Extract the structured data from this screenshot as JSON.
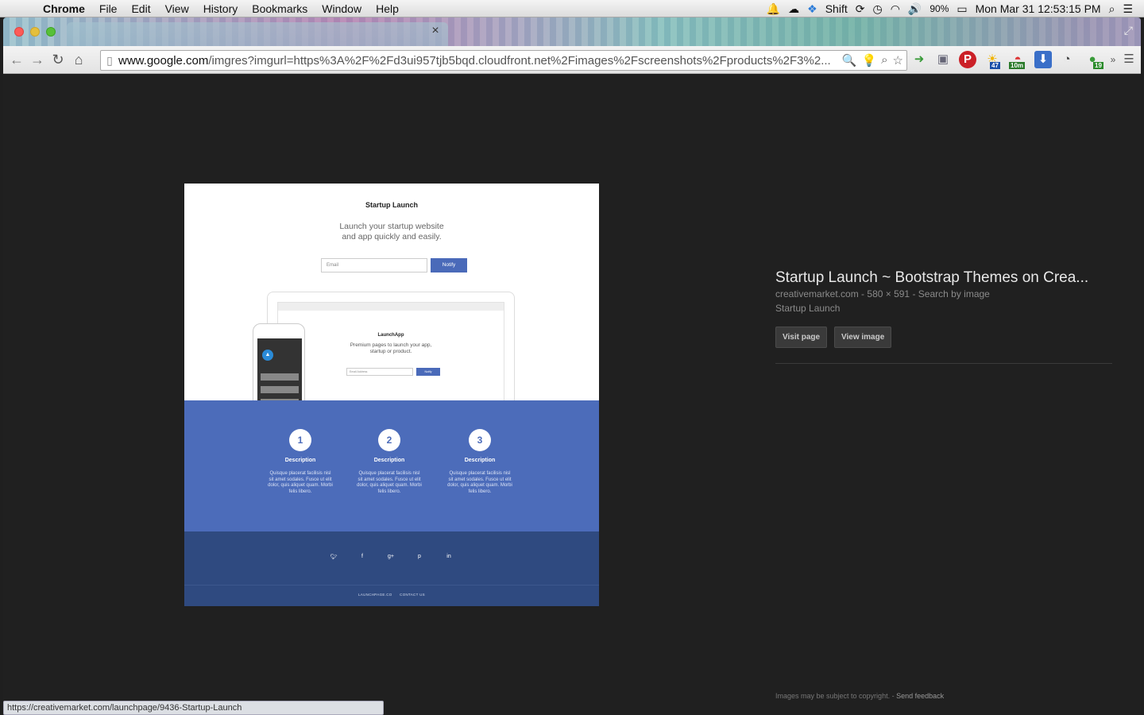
{
  "menubar": {
    "app_name": "Chrome",
    "menus": [
      "File",
      "Edit",
      "View",
      "History",
      "Bookmarks",
      "Window",
      "Help"
    ],
    "status": {
      "shift_label": "Shift",
      "battery": "90%",
      "clock": "Mon Mar 31  12:53:15 PM"
    }
  },
  "tab": {
    "close_glyph": "×"
  },
  "toolbar": {
    "url_host": "www.google.com",
    "url_path": "/imgres?imgurl=https%3A%2F%2Fd3ui957tjb5bqd.cloudfront.net%2Fimages%2Fscreenshots%2Fproducts%2F3%2..."
  },
  "extensions": {
    "badge_1": "47",
    "badge_2": "10m",
    "badge_3": "19"
  },
  "preview": {
    "title": "Startup Launch",
    "subtitle_line1": "Launch your startup website",
    "subtitle_line2": "and app quickly and easily.",
    "email_placeholder": "Email",
    "notify": "Notify",
    "inner": {
      "title": "LaunchApp",
      "sub_line1": "Premium pages to launch your app,",
      "sub_line2": "startup or product.",
      "email": "Email Address",
      "notify": "Notify"
    },
    "steps": [
      {
        "num": "1",
        "label": "Description",
        "desc": "Quisque placerat facilisis nisl sit amet sodales. Fusce ut elit dolor, quis aliquet quam. Morbi felis libero."
      },
      {
        "num": "2",
        "label": "Description",
        "desc": "Quisque placerat facilisis nisl sit amet sodales. Fusce ut elit dolor, quis aliquet quam. Morbi felis libero."
      },
      {
        "num": "3",
        "label": "Description",
        "desc": "Quisque placerat facilisis nisl sit amet sodales. Fusce ut elit dolor, quis aliquet quam. Morbi felis libero."
      }
    ],
    "footer_links": [
      "LAUNCHPAGE.CO",
      "CONTACT US"
    ]
  },
  "info": {
    "title": "Startup Launch ~ Bootstrap Themes on Crea...",
    "site": "creativemarket.com",
    "dims": "580 × 591",
    "search_by_image": "Search by image",
    "description": "Startup Launch",
    "visit_page": "Visit page",
    "view_image": "View image",
    "copyright": "Images may be subject to copyright.",
    "send_feedback": "Send feedback"
  },
  "statusbar": {
    "url": "https://creativemarket.com/launchpage/9436-Startup-Launch"
  },
  "colors": {
    "accent_blue": "#4c6cba",
    "footer_navy": "#2f4a80",
    "background": "#202020"
  }
}
